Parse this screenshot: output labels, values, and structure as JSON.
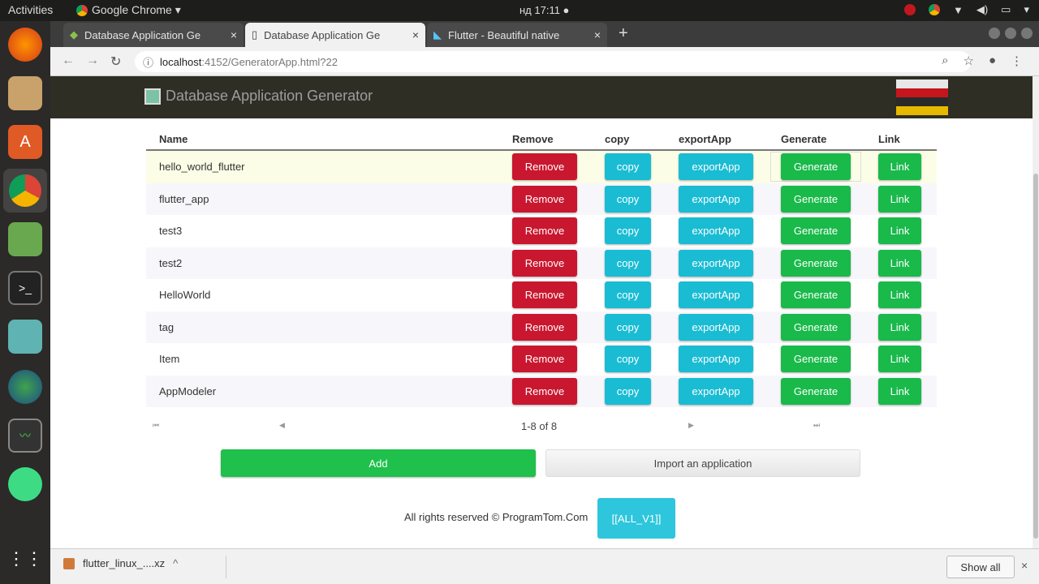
{
  "topbar": {
    "activities": "Activities",
    "app_menu": "Google Chrome ▾",
    "clock": "нд 17:11 ●"
  },
  "tabs": [
    {
      "title": "Database Application Ge",
      "close": "×"
    },
    {
      "title": "Database Application Ge",
      "close": "×"
    },
    {
      "title": "Flutter - Beautiful native",
      "close": "×"
    }
  ],
  "newtab": "+",
  "url": {
    "host": "localhost",
    "rest": ":4152/GeneratorApp.html?22"
  },
  "app": {
    "title": "Database Application Generator",
    "columns": {
      "name": "Name",
      "remove": "Remove",
      "copy": "copy",
      "export": "exportApp",
      "generate": "Generate",
      "link": "Link"
    },
    "rows": [
      {
        "name": "hello_world_flutter",
        "remove": "Remove",
        "copy": "copy",
        "export": "exportApp",
        "generate": "Generate",
        "link": "Link"
      },
      {
        "name": "flutter_app",
        "remove": "Remove",
        "copy": "copy",
        "export": "exportApp",
        "generate": "Generate",
        "link": "Link"
      },
      {
        "name": "test3",
        "remove": "Remove",
        "copy": "copy",
        "export": "exportApp",
        "generate": "Generate",
        "link": "Link"
      },
      {
        "name": "test2",
        "remove": "Remove",
        "copy": "copy",
        "export": "exportApp",
        "generate": "Generate",
        "link": "Link"
      },
      {
        "name": "HelloWorld",
        "remove": "Remove",
        "copy": "copy",
        "export": "exportApp",
        "generate": "Generate",
        "link": "Link"
      },
      {
        "name": "tag",
        "remove": "Remove",
        "copy": "copy",
        "export": "exportApp",
        "generate": "Generate",
        "link": "Link"
      },
      {
        "name": "Item",
        "remove": "Remove",
        "copy": "copy",
        "export": "exportApp",
        "generate": "Generate",
        "link": "Link"
      },
      {
        "name": "AppModeler",
        "remove": "Remove",
        "copy": "copy",
        "export": "exportApp",
        "generate": "Generate",
        "link": "Link"
      }
    ],
    "pager": {
      "first": "⏮",
      "prev": "◀",
      "info": "1-8 of 8",
      "next": "▶",
      "last": "⏭"
    },
    "add_label": "Add",
    "import_label": "Import an application",
    "footer_text": "All rights reserved © ProgramTom.Com",
    "all_label": "[[ALL_V1]]"
  },
  "download": {
    "file": "flutter_linux_....xz",
    "chevron": "^",
    "show_all": "Show all",
    "close": "×"
  },
  "colors": {
    "header": "#2f2e24",
    "remove": "#c9172f",
    "copy": "#19bcd3",
    "generate": "#19b94a",
    "add": "#1fc04b"
  }
}
